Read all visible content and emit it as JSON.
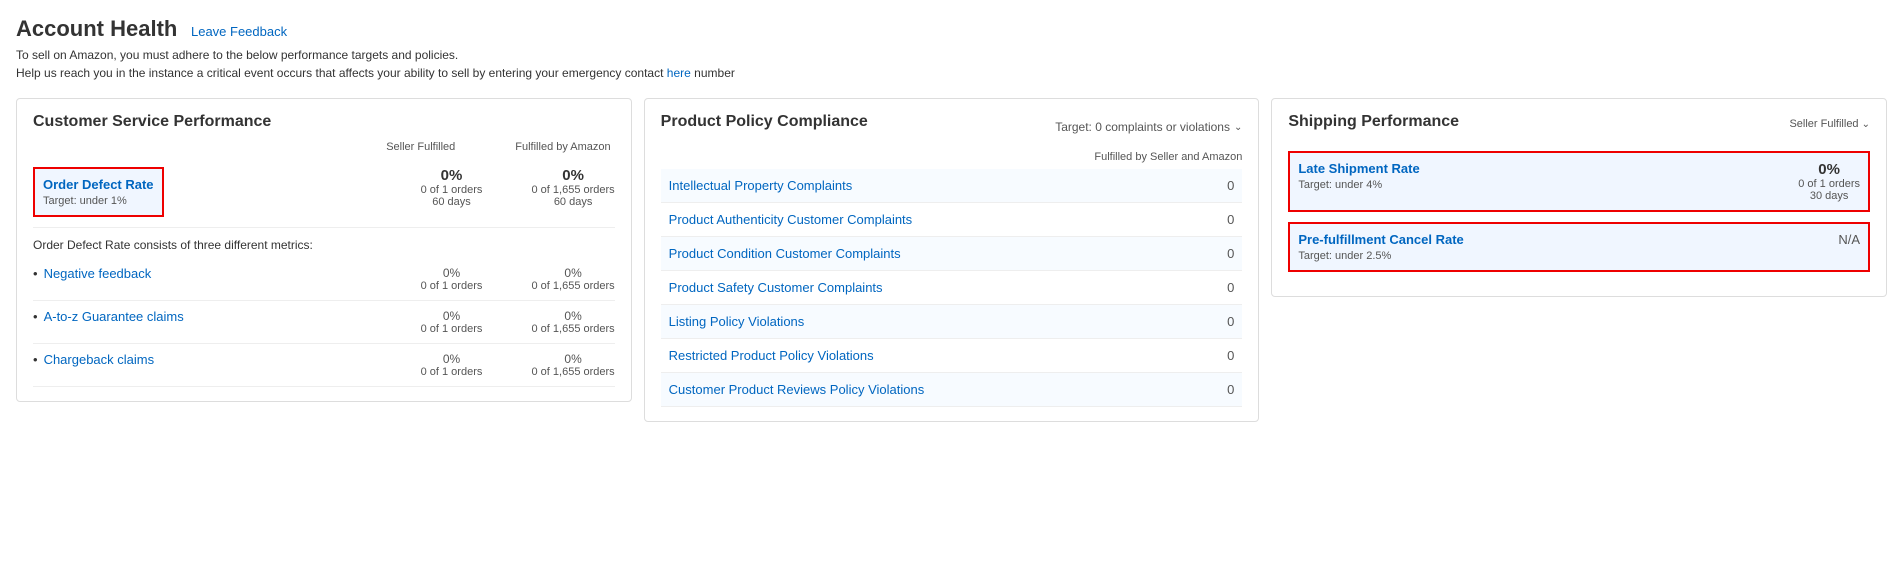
{
  "header": {
    "title": "Account Health",
    "leave_feedback": "Leave Feedback",
    "desc_line1": "To sell on Amazon, you must adhere to the below performance targets and policies.",
    "desc_line2_part1": "Help us reach you in the instance a critical event occurs that affects your ability to sell by entering your emergency contact",
    "desc_line2_link": "here",
    "desc_line2_part2": "number"
  },
  "customer_service": {
    "title": "Customer Service Performance",
    "col1": "Seller Fulfilled",
    "col2": "Fulfilled by Amazon",
    "order_defect": {
      "label": "Order Defect Rate",
      "target": "Target: under 1%",
      "val1": "0%",
      "sub1a": "0 of 1 orders",
      "sub1b": "60 days",
      "val2": "0%",
      "sub2a": "0 of 1,655 orders",
      "sub2b": "60 days"
    },
    "description": "Order Defect Rate consists of three different metrics:",
    "sub_metrics": [
      {
        "label": "Negative feedback",
        "pct1": "0%",
        "orders1": "0 of 1 orders",
        "pct2": "0%",
        "orders2": "0 of 1,655 orders"
      },
      {
        "label": "A-to-z Guarantee claims",
        "pct1": "0%",
        "orders1": "0 of 1 orders",
        "pct2": "0%",
        "orders2": "0 of 1,655 orders"
      },
      {
        "label": "Chargeback claims",
        "pct1": "0%",
        "orders1": "0 of 1 orders",
        "pct2": "0%",
        "orders2": "0 of 1,655 orders"
      }
    ]
  },
  "product_policy": {
    "title": "Product Policy Compliance",
    "target_label": "Target: 0 complaints or violations",
    "col_header": "Fulfilled by Seller and Amazon",
    "rows": [
      {
        "label": "Intellectual Property Complaints",
        "count": "0"
      },
      {
        "label": "Product Authenticity Customer Complaints",
        "count": "0"
      },
      {
        "label": "Product Condition Customer Complaints",
        "count": "0"
      },
      {
        "label": "Product Safety Customer Complaints",
        "count": "0"
      },
      {
        "label": "Listing Policy Violations",
        "count": "0"
      },
      {
        "label": "Restricted Product Policy Violations",
        "count": "0"
      },
      {
        "label": "Customer Product Reviews Policy Violations",
        "count": "0"
      }
    ]
  },
  "shipping": {
    "title": "Shipping Performance",
    "col_header": "Seller Fulfilled",
    "metrics": [
      {
        "label": "Late Shipment Rate",
        "target": "Target: under 4%",
        "value": "0%",
        "sub1": "0 of 1 orders",
        "sub2": "30 days",
        "is_na": false
      },
      {
        "label": "Pre-fulfillment Cancel Rate",
        "target": "Target: under 2.5%",
        "value": "N/A",
        "sub1": "",
        "sub2": "",
        "is_na": true
      }
    ]
  }
}
